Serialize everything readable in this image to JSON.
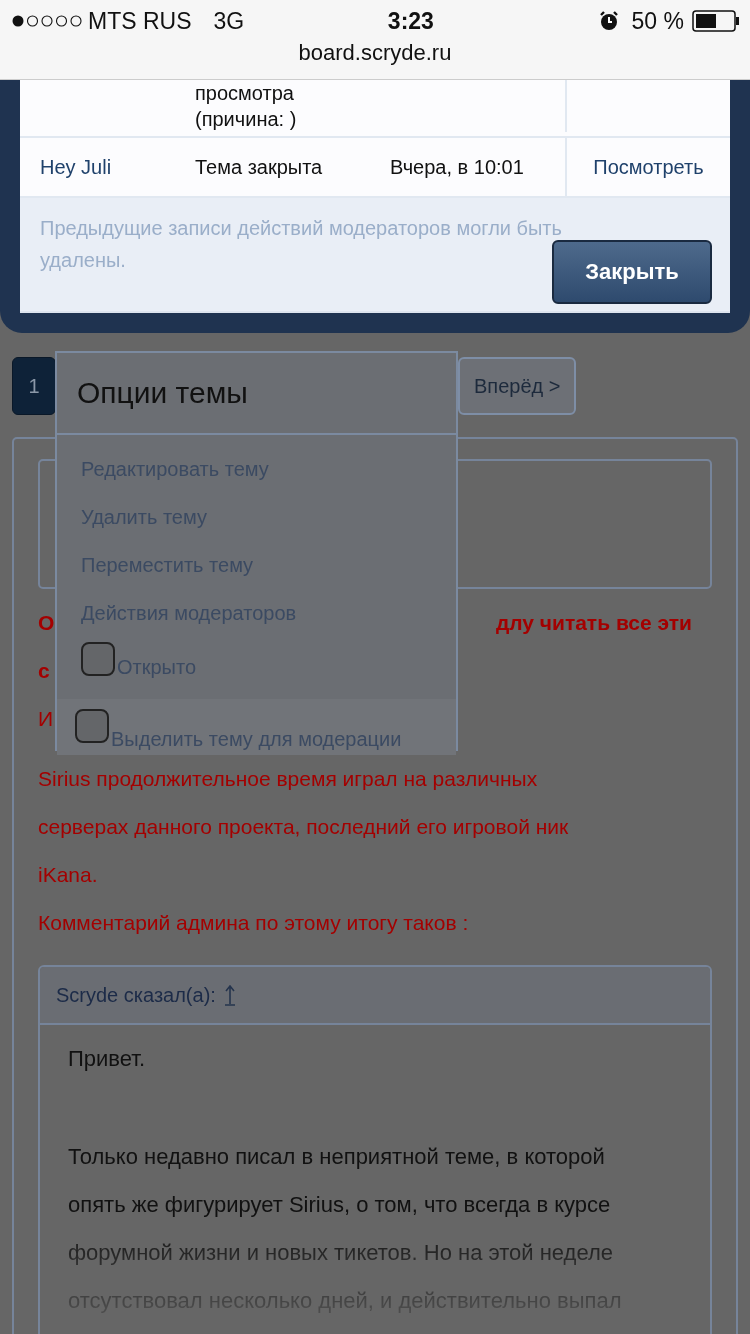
{
  "status_bar": {
    "carrier": "MTS RUS",
    "network": "3G",
    "time": "3:23",
    "battery": "50 %"
  },
  "url": "board.scryde.ru",
  "moderator_log": {
    "rows": [
      {
        "action": [
          "просмотра",
          "(причина: )"
        ]
      },
      {
        "user": "Hey Juli",
        "action": [
          "Тема закрыта"
        ],
        "date": "Вчера, в 10:01",
        "link": "Посмотреть"
      }
    ],
    "note": [
      "Предыдущие записи действий модераторов могли быть",
      "удалены."
    ],
    "close_button": "Закрыть"
  },
  "pagination": [
    {
      "label": "1",
      "selected": true
    },
    {
      "label": "Вперёд >",
      "selected": false
    }
  ],
  "thread_options": {
    "title": "Опции темы",
    "items": [
      "Редактировать тему",
      "Удалить тему",
      "Переместить тему",
      "Действия модераторов"
    ],
    "checkboxes": [
      {
        "label": "Открыто",
        "checked": false
      },
      {
        "label": "Выделить тему для модерации",
        "checked": false
      }
    ]
  },
  "post": {
    "lines": [
      {
        "left": "О",
        "right": "длу читать все эти",
        "bold": true
      },
      {
        "left": "с",
        "bold": true
      },
      {
        "left": "И",
        "bold": false
      }
    ],
    "paragraphs": [
      [
        "Sirius продолжительное время играл на различных",
        "серверах данного проекта, последний его игровой ник",
        "iKana."
      ],
      [
        "Комментарий админа по этому итогу таков :"
      ]
    ],
    "quote": {
      "header": "Scryde сказал(а):",
      "paragraphs": [
        [
          "Привет."
        ],
        [
          "Только недавно писал в неприятной теме, в которой",
          "опять же фигурирует Sirius, о том, что всегда в курсе",
          "форумной жизни и новых тикетов. Но на этой неделе",
          "отсутствовал несколько дней, и действительно выпал"
        ]
      ]
    }
  }
}
